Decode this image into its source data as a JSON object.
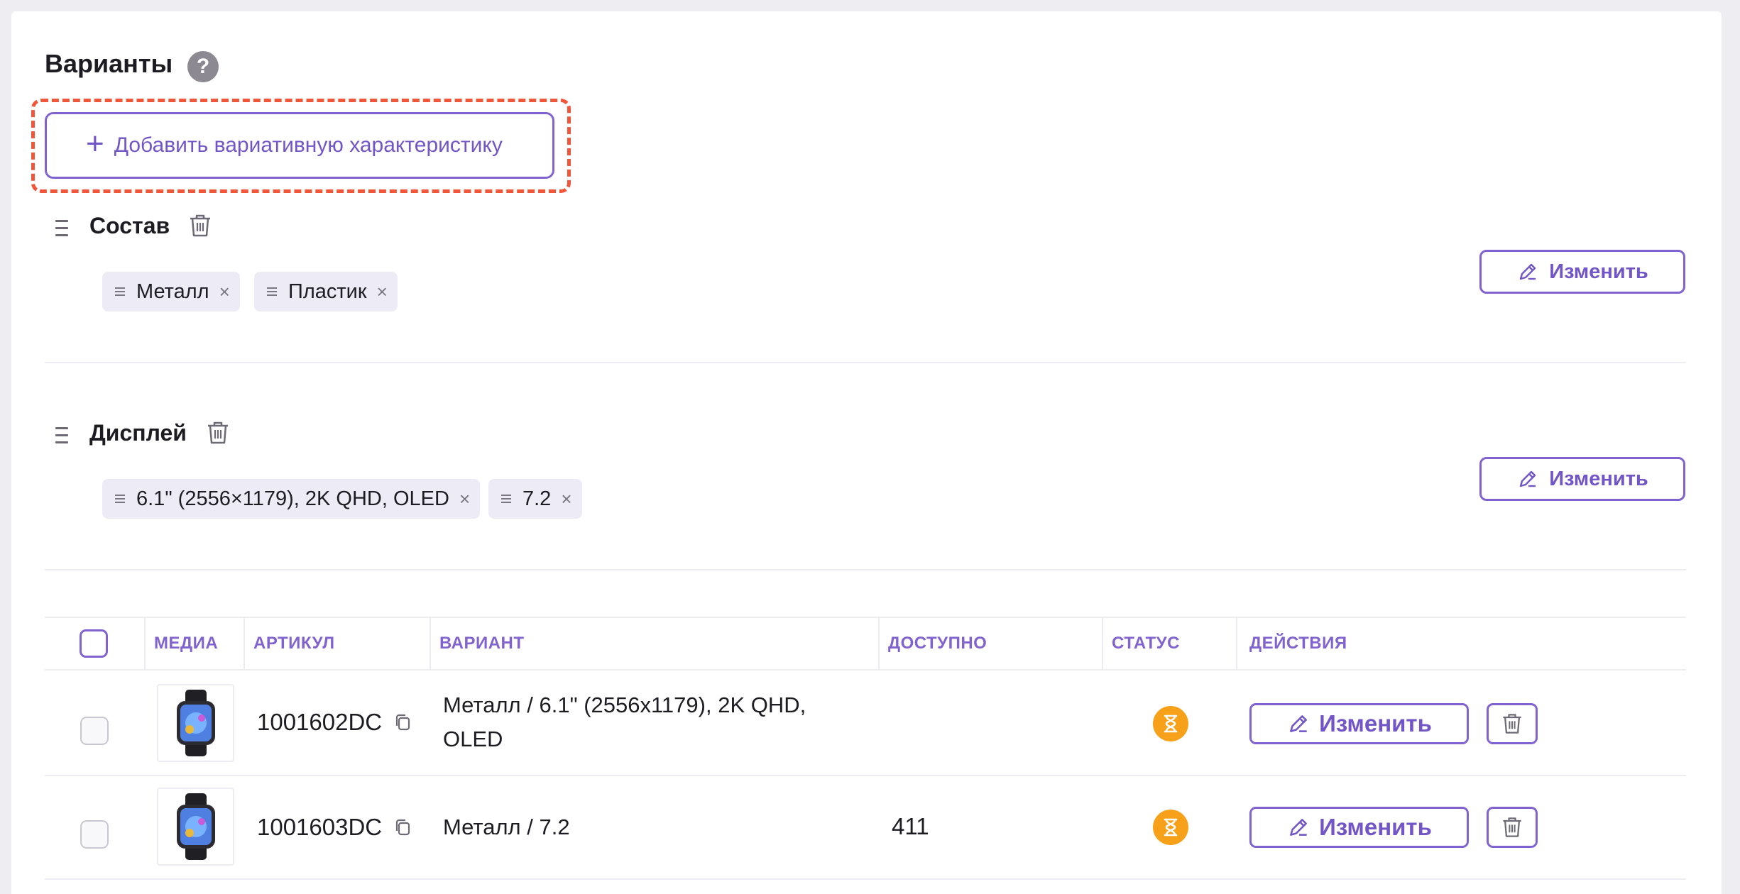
{
  "section": {
    "title": "Варианты",
    "help_icon": "question-icon",
    "add_label": "Добавить вариативную характеристику"
  },
  "groups": [
    {
      "title": "Состав",
      "values": [
        "Металл",
        "Пластик"
      ],
      "edit_label": "Изменить"
    },
    {
      "title": "Дисплей",
      "values": [
        "6.1\" (2556×1179), 2K QHD, OLED",
        "7.2"
      ],
      "edit_label": "Изменить"
    }
  ],
  "table": {
    "headers": {
      "media": "МЕДИА",
      "sku": "АРТИКУЛ",
      "variant": "ВАРИАНТ",
      "available": "ДОСТУПНО",
      "status": "СТАТУС",
      "actions": "ДЕЙСТВИЯ"
    },
    "rows": [
      {
        "sku": "1001602DC",
        "variant": "Металл / 6.1\" (2556x1179), 2K QHD, OLED",
        "available": "",
        "status_icon": "hourglass-icon",
        "edit_label": "Изменить"
      },
      {
        "sku": "1001603DC",
        "variant": "Металл / 7.2",
        "available": "411",
        "status_icon": "hourglass-icon",
        "edit_label": "Изменить"
      }
    ]
  },
  "colors": {
    "accent": "#8163d0",
    "highlight_dash": "#f1553a",
    "status_pending": "#f7a11a",
    "chip_bg": "#edebf6"
  }
}
